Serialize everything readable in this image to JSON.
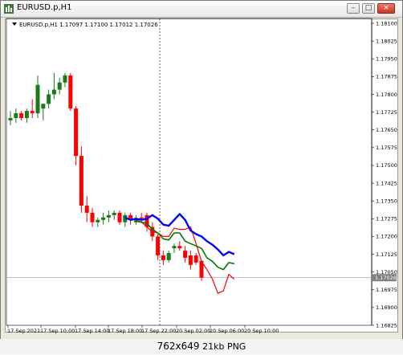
{
  "window": {
    "title": "EURUSD.p,H1",
    "buttons": {
      "minimize": "–",
      "maximize": "□",
      "close": "×"
    }
  },
  "header": {
    "info_text": "EURUSD.p,H1  1.17097 1.17100 1.17012 1.17026"
  },
  "colors": {
    "bull": "#1a7a1a",
    "bear": "#ff0000",
    "ma_blue": "#0000ff",
    "ma_green": "#007a00",
    "ma_red": "#ff0000",
    "price_label_bg": "#808080"
  },
  "chart_data": {
    "type": "candlestick",
    "symbol": "EURUSD.p",
    "timeframe": "H1",
    "ylim": [
      1.16825,
      1.181
    ],
    "y_ticks": [
      "1.18100",
      "1.18025",
      "1.17950",
      "1.17875",
      "1.17800",
      "1.17725",
      "1.17650",
      "1.17575",
      "1.17500",
      "1.17425",
      "1.17350",
      "1.17275",
      "1.17200",
      "1.17125",
      "1.17050",
      "1.16975",
      "1.16900",
      "1.16825"
    ],
    "x_labels": [
      "17 Sep 2021",
      "17 Sep 10:00",
      "17 Sep 14:00",
      "17 Sep 18:00",
      "17 Sep 22:00",
      "20 Sep 02:00",
      "20 Sep 06:00",
      "20 Sep 10:00"
    ],
    "current_price": "1.17026",
    "candles": [
      {
        "o": 1.1769,
        "h": 1.1773,
        "l": 1.1767,
        "c": 1.177
      },
      {
        "o": 1.177,
        "h": 1.1774,
        "l": 1.1768,
        "c": 1.1772
      },
      {
        "o": 1.1772,
        "h": 1.1773,
        "l": 1.1769,
        "c": 1.177
      },
      {
        "o": 1.177,
        "h": 1.1774,
        "l": 1.1768,
        "c": 1.1773
      },
      {
        "o": 1.1773,
        "h": 1.1778,
        "l": 1.177,
        "c": 1.1772
      },
      {
        "o": 1.1772,
        "h": 1.1788,
        "l": 1.177,
        "c": 1.1784
      },
      {
        "o": 1.1774,
        "h": 1.1776,
        "l": 1.1769,
        "c": 1.1776
      },
      {
        "o": 1.1776,
        "h": 1.1782,
        "l": 1.1774,
        "c": 1.178
      },
      {
        "o": 1.178,
        "h": 1.1789,
        "l": 1.1778,
        "c": 1.1782
      },
      {
        "o": 1.1782,
        "h": 1.1787,
        "l": 1.178,
        "c": 1.1785
      },
      {
        "o": 1.1785,
        "h": 1.1789,
        "l": 1.1783,
        "c": 1.1788
      },
      {
        "o": 1.1788,
        "h": 1.1789,
        "l": 1.1773,
        "c": 1.1774
      },
      {
        "o": 1.1774,
        "h": 1.1775,
        "l": 1.175,
        "c": 1.1754
      },
      {
        "o": 1.1754,
        "h": 1.1758,
        "l": 1.173,
        "c": 1.1733
      },
      {
        "o": 1.1733,
        "h": 1.1737,
        "l": 1.1726,
        "c": 1.173
      },
      {
        "o": 1.173,
        "h": 1.1732,
        "l": 1.1724,
        "c": 1.1726
      },
      {
        "o": 1.1726,
        "h": 1.1728,
        "l": 1.1724,
        "c": 1.1727
      },
      {
        "o": 1.1727,
        "h": 1.173,
        "l": 1.1725,
        "c": 1.1728
      },
      {
        "o": 1.1728,
        "h": 1.1731,
        "l": 1.1726,
        "c": 1.1729
      },
      {
        "o": 1.1729,
        "h": 1.1731,
        "l": 1.1727,
        "c": 1.173
      },
      {
        "o": 1.173,
        "h": 1.1731,
        "l": 1.1725,
        "c": 1.1726
      },
      {
        "o": 1.1726,
        "h": 1.173,
        "l": 1.1724,
        "c": 1.1729
      },
      {
        "o": 1.1729,
        "h": 1.173,
        "l": 1.1725,
        "c": 1.1727
      },
      {
        "o": 1.1726,
        "h": 1.1729,
        "l": 1.1725,
        "c": 1.1727
      },
      {
        "o": 1.1728,
        "h": 1.173,
        "l": 1.1726,
        "c": 1.1727
      },
      {
        "o": 1.1729,
        "h": 1.173,
        "l": 1.1722,
        "c": 1.1724
      },
      {
        "o": 1.1724,
        "h": 1.1726,
        "l": 1.1718,
        "c": 1.172
      },
      {
        "o": 1.172,
        "h": 1.1721,
        "l": 1.171,
        "c": 1.1712
      },
      {
        "o": 1.1712,
        "h": 1.1714,
        "l": 1.1708,
        "c": 1.171
      },
      {
        "o": 1.171,
        "h": 1.1714,
        "l": 1.1709,
        "c": 1.1713
      },
      {
        "o": 1.1715,
        "h": 1.1717,
        "l": 1.1713,
        "c": 1.1716
      },
      {
        "o": 1.1716,
        "h": 1.1718,
        "l": 1.1714,
        "c": 1.1715
      },
      {
        "o": 1.1714,
        "h": 1.1716,
        "l": 1.1709,
        "c": 1.1711
      },
      {
        "o": 1.1712,
        "h": 1.1714,
        "l": 1.1706,
        "c": 1.1708
      },
      {
        "o": 1.1712,
        "h": 1.1713,
        "l": 1.1708,
        "c": 1.1709
      },
      {
        "o": 1.17097,
        "h": 1.171,
        "l": 1.17012,
        "c": 1.17026
      }
    ],
    "ma_blue": [
      null,
      null,
      null,
      null,
      null,
      null,
      null,
      null,
      null,
      null,
      null,
      null,
      null,
      null,
      null,
      null,
      null,
      null,
      null,
      null,
      null,
      1.1728,
      1.1727,
      1.17275,
      1.1727,
      1.17275,
      1.1729,
      1.17275,
      1.1725,
      1.17245,
      1.1727,
      1.17295,
      1.1727,
      1.17225,
      1.1721,
      1.172,
      1.1718,
      1.17165,
      1.17145,
      1.1712,
      1.17135,
      1.17125
    ],
    "ma_green": [
      null,
      null,
      null,
      null,
      null,
      null,
      null,
      null,
      null,
      null,
      null,
      null,
      null,
      null,
      null,
      null,
      null,
      null,
      null,
      null,
      null,
      null,
      null,
      1.17265,
      1.1726,
      1.17255,
      1.1723,
      1.17215,
      1.1719,
      1.17185,
      1.17215,
      1.17215,
      1.1718,
      1.1717,
      1.1716,
      1.1715,
      1.1711,
      1.17095,
      1.1707,
      1.1706,
      1.1709,
      1.17085
    ],
    "ma_red": [
      null,
      null,
      null,
      null,
      null,
      null,
      null,
      null,
      null,
      null,
      null,
      null,
      null,
      null,
      null,
      null,
      null,
      null,
      null,
      null,
      null,
      null,
      null,
      1.1727,
      1.1726,
      1.1724,
      1.1722,
      1.17215,
      1.172,
      1.172,
      1.17235,
      1.1723,
      1.1723,
      1.1724,
      1.1717,
      1.17095,
      1.1706,
      1.1702,
      1.1696,
      1.1697,
      1.1704,
      1.1702
    ]
  },
  "caption": {
    "dims": "762x649",
    "size": "21kb",
    "format": "PNG"
  }
}
